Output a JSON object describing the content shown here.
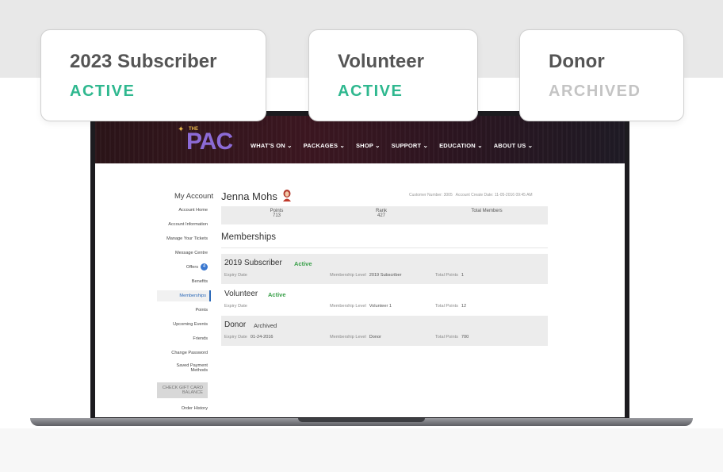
{
  "colors": {
    "active": "#2fb88f",
    "archived": "#c4c4c4",
    "site_active": "#3aa04a",
    "accent": "#2a68b8"
  },
  "cards": [
    {
      "title": "2023 Subscriber",
      "status": "ACTIVE"
    },
    {
      "title": "Volunteer",
      "status": "ACTIVE"
    },
    {
      "title": "Donor",
      "status": "ARCHIVED"
    }
  ],
  "site": {
    "logo_small": "THE",
    "logo": "PAC",
    "nav": [
      {
        "label": "WHAT'S ON ⌄"
      },
      {
        "label": "PACKAGES ⌄"
      },
      {
        "label": "SHOP ⌄"
      },
      {
        "label": "SUPPORT ⌄"
      },
      {
        "label": "EDUCATION ⌄"
      },
      {
        "label": "ABOUT US ⌄"
      }
    ]
  },
  "sidebar": {
    "title": "My Account",
    "items": [
      {
        "label": "Account Home"
      },
      {
        "label": "Account Information"
      },
      {
        "label": "Manage Your Tickets"
      },
      {
        "label": "Message Centre"
      },
      {
        "label": "Offers",
        "badge": "4"
      },
      {
        "label": "Benefits"
      },
      {
        "label": "Memberships"
      },
      {
        "label": "Points"
      },
      {
        "label": "Upcoming Events"
      },
      {
        "label": "Friends"
      },
      {
        "label": "Change Password"
      },
      {
        "label": "Saved Payment Methods"
      },
      {
        "label": "CHECK GIFT CARD BALANCE"
      },
      {
        "label": "Order History"
      }
    ]
  },
  "account": {
    "name": "Jenna Mohs",
    "customer_number": "Customer Number: 3005",
    "create_date": "Account Create Date: 11-05-2016 09:45 AM",
    "stats": {
      "points_label": "Points",
      "points_value": "713",
      "rank_label": "Rank",
      "rank_value": "427",
      "members_label": "Total Members"
    }
  },
  "memberships": {
    "heading": "Memberships",
    "rows": [
      {
        "name": "2019 Subscriber",
        "status": "Active",
        "expiry_label": "Expiry Date",
        "expiry_value": "",
        "level_label": "Membership Level",
        "level_value": "2019 Subscriber",
        "points_label": "Total Points",
        "points_value": "1"
      },
      {
        "name": "Volunteer",
        "status": "Active",
        "expiry_label": "Expiry Date",
        "expiry_value": "",
        "level_label": "Membership Level",
        "level_value": "Volunteer 1",
        "points_label": "Total Points",
        "points_value": "12"
      },
      {
        "name": "Donor",
        "status": "Archived",
        "expiry_label": "Expiry Date",
        "expiry_value": "01-24-2016",
        "level_label": "Membership Level",
        "level_value": "Donor",
        "points_label": "Total Points",
        "points_value": "700"
      }
    ]
  }
}
